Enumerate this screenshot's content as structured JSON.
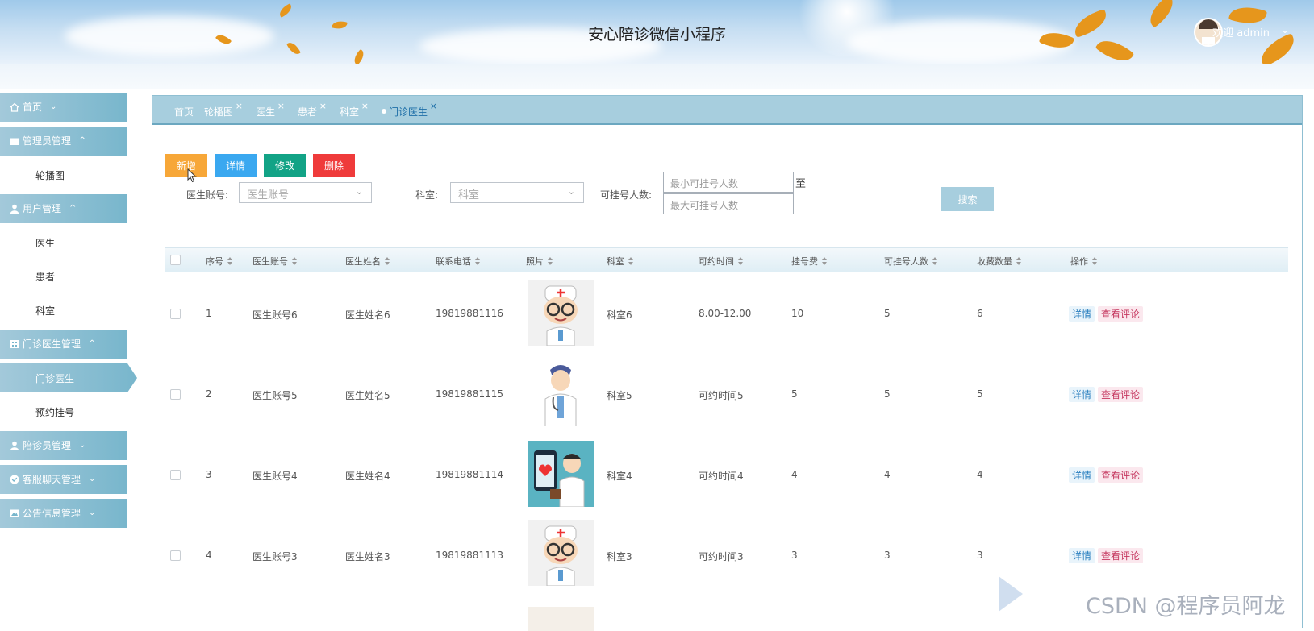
{
  "header": {
    "title": "安心陪诊微信小程序",
    "welcome": "欢迎 admin"
  },
  "sidebar": {
    "groups": [
      {
        "label": "首页",
        "icon": "home-icon",
        "chevron": "down"
      },
      {
        "label": "管理员管理",
        "icon": "gift-icon",
        "chevron": "up",
        "items": [
          "轮播图"
        ]
      },
      {
        "label": "用户管理",
        "icon": "user-icon",
        "chevron": "up",
        "items": [
          "医生",
          "患者",
          "科室"
        ]
      },
      {
        "label": "门诊医生管理",
        "icon": "building-icon",
        "chevron": "up",
        "items": [
          "门诊医生",
          "预约挂号"
        ]
      },
      {
        "label": "陪诊员管理",
        "icon": "user-icon",
        "chevron": "down"
      },
      {
        "label": "客服聊天管理",
        "icon": "check-circle-icon",
        "chevron": "down"
      },
      {
        "label": "公告信息管理",
        "icon": "image-icon",
        "chevron": "down"
      }
    ],
    "active_item": "门诊医生"
  },
  "tabs": [
    "首页",
    "轮播图",
    "医生",
    "患者",
    "科室",
    "门诊医生"
  ],
  "active_tab": "门诊医生",
  "toolbar": {
    "add": "新增",
    "detail": "详情",
    "edit": "修改",
    "delete": "删除"
  },
  "filters": {
    "doctor_account_label": "医生账号:",
    "doctor_account_placeholder": "医生账号",
    "department_label": "科室:",
    "department_placeholder": "科室",
    "quota_label": "可挂号人数:",
    "min_placeholder": "最小可挂号人数",
    "max_placeholder": "最大可挂号人数",
    "to_label": "至",
    "search_button": "搜索"
  },
  "table": {
    "columns": [
      "序号",
      "医生账号",
      "医生姓名",
      "联系电话",
      "照片",
      "科室",
      "可约时间",
      "挂号费",
      "可挂号人数",
      "收藏数量",
      "操作"
    ],
    "rows": [
      {
        "no": "1",
        "account": "医生账号6",
        "name": "医生姓名6",
        "phone": "19819881116",
        "dept": "科室6",
        "time": "8.00-12.00",
        "fee": "10",
        "quota": "5",
        "fav": "6",
        "photo": "doctor-glasses"
      },
      {
        "no": "2",
        "account": "医生账号5",
        "name": "医生姓名5",
        "phone": "19819881115",
        "dept": "科室5",
        "time": "可约时间5",
        "fee": "5",
        "quota": "5",
        "fav": "5",
        "photo": "doctor-standing"
      },
      {
        "no": "3",
        "account": "医生账号4",
        "name": "医生姓名4",
        "phone": "19819881114",
        "dept": "科室4",
        "time": "可约时间4",
        "fee": "4",
        "quota": "4",
        "fav": "4",
        "photo": "doctor-phone"
      },
      {
        "no": "4",
        "account": "医生账号3",
        "name": "医生姓名3",
        "phone": "19819881113",
        "dept": "科室3",
        "time": "可约时间3",
        "fee": "3",
        "quota": "3",
        "fav": "3",
        "photo": "doctor-glasses"
      }
    ],
    "row_actions": {
      "detail": "详情",
      "review": "查看评论"
    }
  },
  "watermark": "CSDN @程序员阿龙",
  "colors": {
    "sidebar": "#78b6cc",
    "tabs": "#a7cede",
    "add": "#f7a738",
    "detail": "#3aa8f0",
    "edit": "#12a386",
    "delete": "#ef3b3b"
  }
}
